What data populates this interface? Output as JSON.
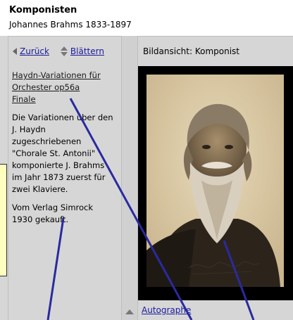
{
  "header": {
    "title": "Komponisten",
    "subtitle": "Johannes Brahms 1833-1897"
  },
  "nav": {
    "back_label": "Zurück",
    "browse_label": "Blättern"
  },
  "image_panel": {
    "header": "Bildansicht: Komponist",
    "footer_link": "Autographe"
  },
  "work": {
    "link_lines": [
      "Haydn-Variationen für",
      "Orchester op56a",
      "Finale"
    ],
    "description_lines": [
      "Die Variationen über den",
      "J. Haydn",
      "zugeschriebenen",
      "\"Chorale St. Antonii\"",
      "komponierte J. Brahms",
      "im Jahr 1873 zuerst für",
      "zwei Klaviere."
    ],
    "publisher_lines": [
      "Vom Verlag Simrock",
      "1930 gekauft."
    ]
  },
  "colors": {
    "panel_bg": "#d6d6d6",
    "link_blue": "#1a1a9e",
    "annotation_line": "#2a2aa0",
    "tooltip_bg": "#ffffc0"
  },
  "icons": {
    "back": "triangle-left-icon",
    "browse": "up-down-arrows-icon",
    "scroll": "triangle-up-icon"
  }
}
